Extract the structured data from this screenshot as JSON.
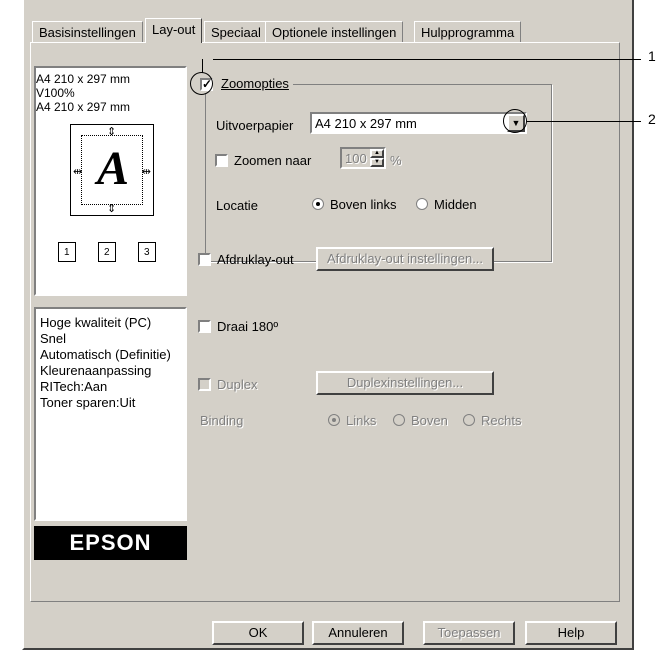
{
  "tabs": [
    "Basisinstellingen",
    "Lay-out",
    "Speciaal",
    "Optionele instellingen",
    "Hulpprogramma"
  ],
  "active_tab": "Lay-out",
  "preview": {
    "lines": [
      "A4 210 x 297 mm",
      "V100%",
      "A4 210 x 297 mm"
    ],
    "letter": "A",
    "pages": [
      "1",
      "2",
      "3"
    ]
  },
  "summary": [
    "Hoge kwaliteit (PC)",
    "Snel",
    "Automatisch (Definitie)",
    "Kleurenaanpassing",
    "RITech:Aan",
    "Toner sparen:Uit"
  ],
  "logo": "EPSON",
  "zoom": {
    "enabled": true,
    "label": "Zoomopties",
    "output_paper_label": "Uitvoerpapier",
    "output_paper_value": "A4 210 x 297 mm",
    "zoom_to_label": "Zoomen naar",
    "zoom_to_value": "100",
    "zoom_unit": "%",
    "location_label": "Locatie",
    "location_options": [
      "Boven links",
      "Midden"
    ],
    "location_selected": "Boven links"
  },
  "layout": {
    "label": "Afdruklay-out",
    "button": "Afdruklay-out instellingen..."
  },
  "rotate": {
    "label": "Draai 180º"
  },
  "duplex": {
    "label": "Duplex",
    "button": "Duplexinstellingen...",
    "binding_label": "Binding",
    "binding_options": [
      "Links",
      "Boven",
      "Rechts"
    ],
    "binding_selected": "Links"
  },
  "buttons": {
    "ok": "OK",
    "cancel": "Annuleren",
    "apply": "Toepassen",
    "help": "Help"
  },
  "callouts": [
    "1",
    "2"
  ]
}
